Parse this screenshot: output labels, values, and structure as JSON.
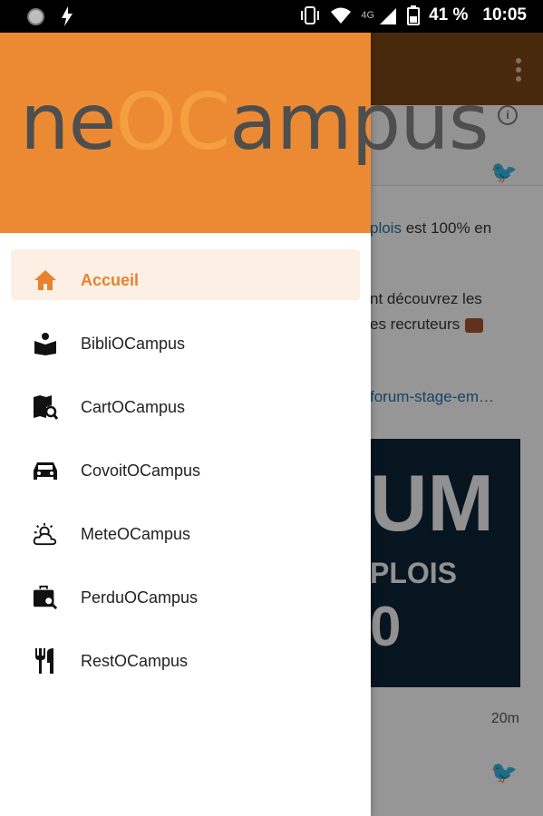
{
  "status_bar": {
    "network": "4G",
    "battery": "41 %",
    "time": "10:05"
  },
  "drawer": {
    "logo": {
      "part1": "ne",
      "part2": "OC",
      "part3": "ampus"
    },
    "items": [
      {
        "label": "Accueil",
        "icon": "home-icon",
        "active": true
      },
      {
        "label": "BibliOCampus",
        "icon": "book-reader-icon",
        "active": false
      },
      {
        "label": "CartOCampus",
        "icon": "map-search-icon",
        "active": false
      },
      {
        "label": "CovoitOCampus",
        "icon": "car-icon",
        "active": false
      },
      {
        "label": "MeteOCampus",
        "icon": "weather-icon",
        "active": false
      },
      {
        "label": "PerduOCampus",
        "icon": "lost-luggage-icon",
        "active": false
      },
      {
        "label": "RestOCampus",
        "icon": "restaurant-icon",
        "active": false
      }
    ]
  },
  "background": {
    "tweet_line1": "plois",
    "tweet_line1b": " est 100% en",
    "tweet_line2": "nt découvrez les",
    "tweet_line3": "es recruteurs",
    "tweet_link": "forum-stage-em…",
    "image_big": "UM",
    "image_mid": "PLOIS",
    "image_dig": "0",
    "time": "20m"
  },
  "colors": {
    "accent": "#ec8a33",
    "active_bg": "#fcefe4",
    "active_text": "#e8822e"
  }
}
